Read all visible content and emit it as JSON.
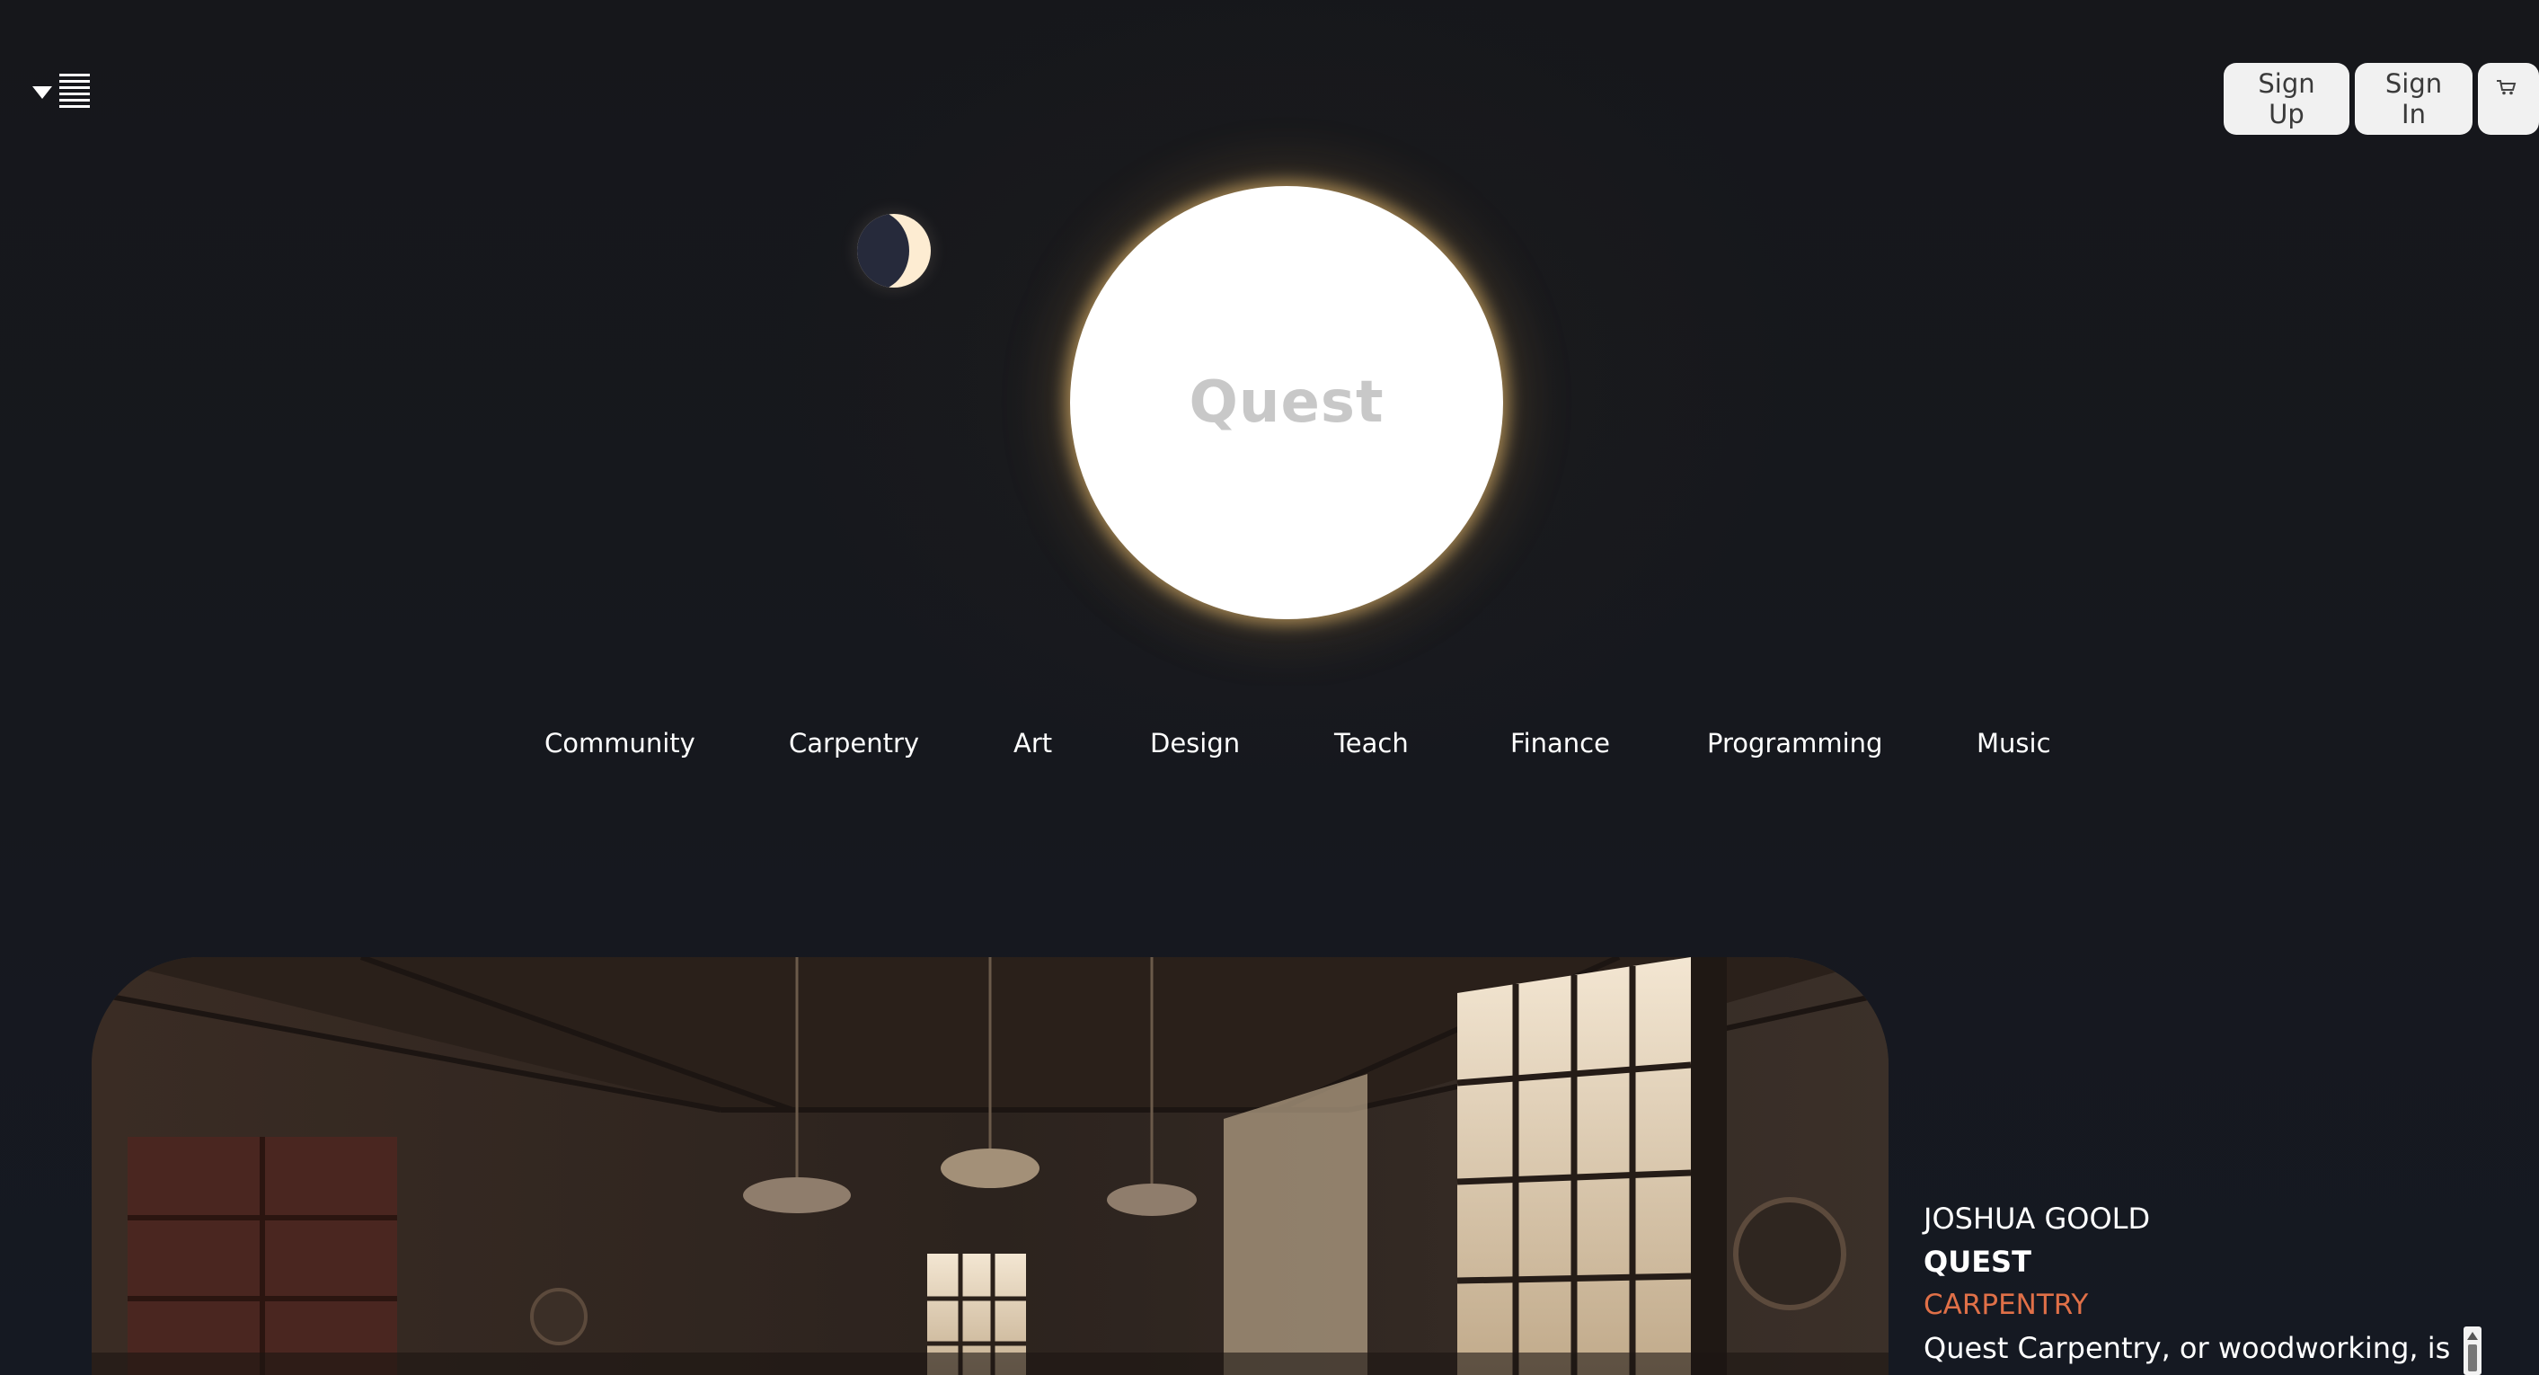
{
  "header": {
    "menu_icon": "menu-toggle-icon",
    "auth": {
      "signup_label": "Sign Up",
      "signin_label": "Sign In",
      "cart_icon": "cart-icon"
    }
  },
  "hero": {
    "title": "Quest",
    "theme_toggle_icon": "moon-icon"
  },
  "nav": {
    "items": [
      {
        "label": "Community"
      },
      {
        "label": "Carpentry"
      },
      {
        "label": "Art"
      },
      {
        "label": "Design"
      },
      {
        "label": "Teach"
      },
      {
        "label": "Finance"
      },
      {
        "label": "Programming"
      },
      {
        "label": "Music"
      }
    ]
  },
  "feature": {
    "image_alt": "",
    "author": "JOSHUA GOOLD",
    "brand": "QUEST",
    "category": "CARPENTRY",
    "blurb": "Quest Carpentry, or woodworking, is"
  },
  "colors": {
    "background": "#16171b",
    "accent": "#e07048",
    "button_bg": "#f1f1f1",
    "sun": "#ffffff",
    "sun_text": "#c8c8c8"
  }
}
